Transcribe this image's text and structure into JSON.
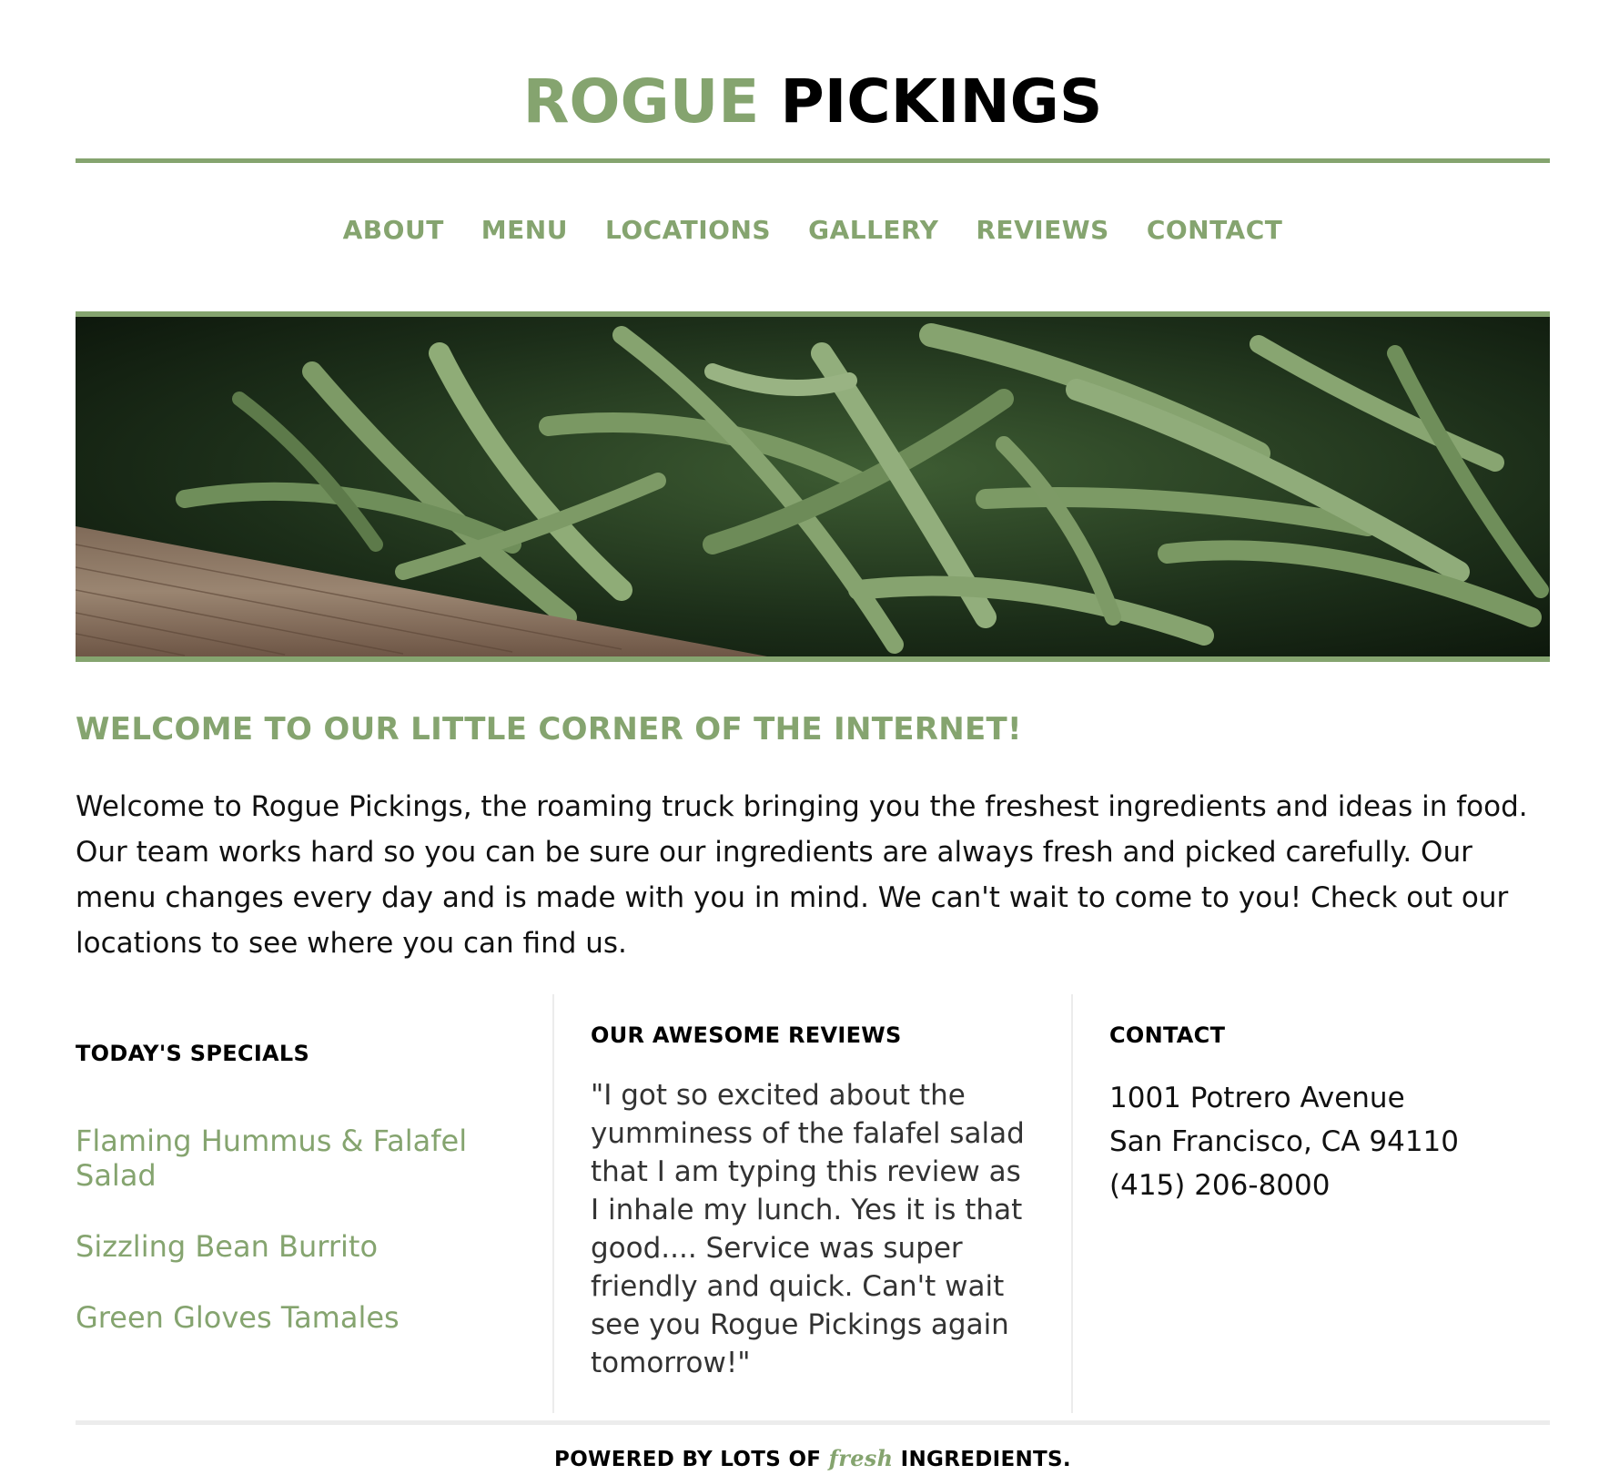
{
  "header": {
    "brand_word1": "ROGUE",
    "brand_word2": "PICKINGS"
  },
  "nav": {
    "items": [
      {
        "label": "ABOUT"
      },
      {
        "label": "MENU"
      },
      {
        "label": "LOCATIONS"
      },
      {
        "label": "GALLERY"
      },
      {
        "label": "REVIEWS"
      },
      {
        "label": "CONTACT"
      }
    ]
  },
  "hero": {
    "description": "",
    "icon": "green-beans-photo"
  },
  "welcome": {
    "title": "WELCOME TO OUR LITTLE CORNER OF THE INTERNET!",
    "body": "Welcome to Rogue Pickings, the roaming truck bringing you the freshest ingredients and ideas in food. Our team works hard so you can be sure our ingredients are always fresh and picked carefully. Our menu changes every day and is made with you in mind. We can't wait to come to you! Check out our locations to see where you can find us."
  },
  "specials": {
    "title": "TODAY'S SPECIALS",
    "items": [
      {
        "label": "Flaming Hummus & Falafel Salad"
      },
      {
        "label": "Sizzling Bean Burrito"
      },
      {
        "label": "Green Gloves Tamales"
      }
    ]
  },
  "reviews": {
    "title": "OUR AWESOME REVIEWS",
    "quote": "\"I got so excited about the yumminess of the falafel salad that I am typing this review as I inhale my lunch. Yes it is that good.... Service was super friendly and quick. Can't wait see you Rogue Pickings again tomorrow!\""
  },
  "contact": {
    "title": "CONTACT",
    "address_line1": "1001 Potrero Avenue",
    "address_line2": "San Francisco, CA 94110",
    "phone": "(415) 206-8000"
  },
  "footer": {
    "prefix": "POWERED BY LOTS OF",
    "highlight": "fresh",
    "suffix": "INGREDIENTS."
  },
  "colors": {
    "accent": "#85a46f",
    "divider": "#ececec",
    "text": "#000000"
  }
}
